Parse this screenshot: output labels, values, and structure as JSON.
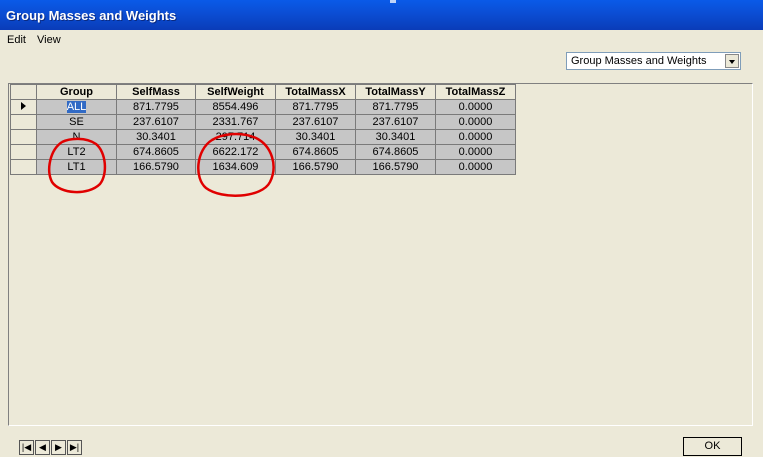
{
  "window": {
    "title": "Group Masses and Weights"
  },
  "menu": {
    "edit": "Edit",
    "view": "View"
  },
  "selector": {
    "value": "Group Masses and Weights"
  },
  "table": {
    "headers": [
      "Group",
      "SelfMass",
      "SelfWeight",
      "TotalMassX",
      "TotalMassY",
      "TotalMassZ"
    ],
    "rows": [
      [
        "ALL",
        "871.7795",
        "8554.496",
        "871.7795",
        "871.7795",
        "0.0000"
      ],
      [
        "SE",
        "237.6107",
        "2331.767",
        "237.6107",
        "237.6107",
        "0.0000"
      ],
      [
        "N",
        "30.3401",
        "297.714",
        "30.3401",
        "30.3401",
        "0.0000"
      ],
      [
        "LT2",
        "674.8605",
        "6622.172",
        "674.8605",
        "674.8605",
        "0.0000"
      ],
      [
        "LT1",
        "166.5790",
        "1634.609",
        "166.5790",
        "166.5790",
        "0.0000"
      ]
    ]
  },
  "nav": {
    "first": "|◀",
    "prev": "◀",
    "next": "▶",
    "last": "▶|"
  },
  "ok_label": "OK",
  "annotation_color": "#e00000"
}
